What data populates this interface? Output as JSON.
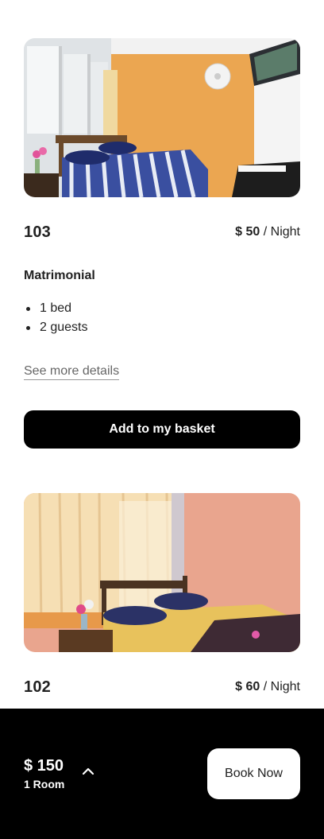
{
  "rooms": [
    {
      "number": "103",
      "price": "$ 50",
      "price_unit": "/ Night",
      "type": "Matrimonial",
      "features": [
        "1 bed",
        "2 guests"
      ],
      "details_link": "See more details",
      "add_button": "Add to my basket"
    },
    {
      "number": "102",
      "price": "$ 60",
      "price_unit": "/ Night"
    }
  ],
  "basket": {
    "total": "$ 150",
    "room_count": "1 Room",
    "book_button": "Book Now"
  },
  "icons": {
    "expand": "chevron-up-icon"
  },
  "colors": {
    "primary": "#000000",
    "background": "#ffffff",
    "text": "#222222",
    "link": "#666666"
  }
}
